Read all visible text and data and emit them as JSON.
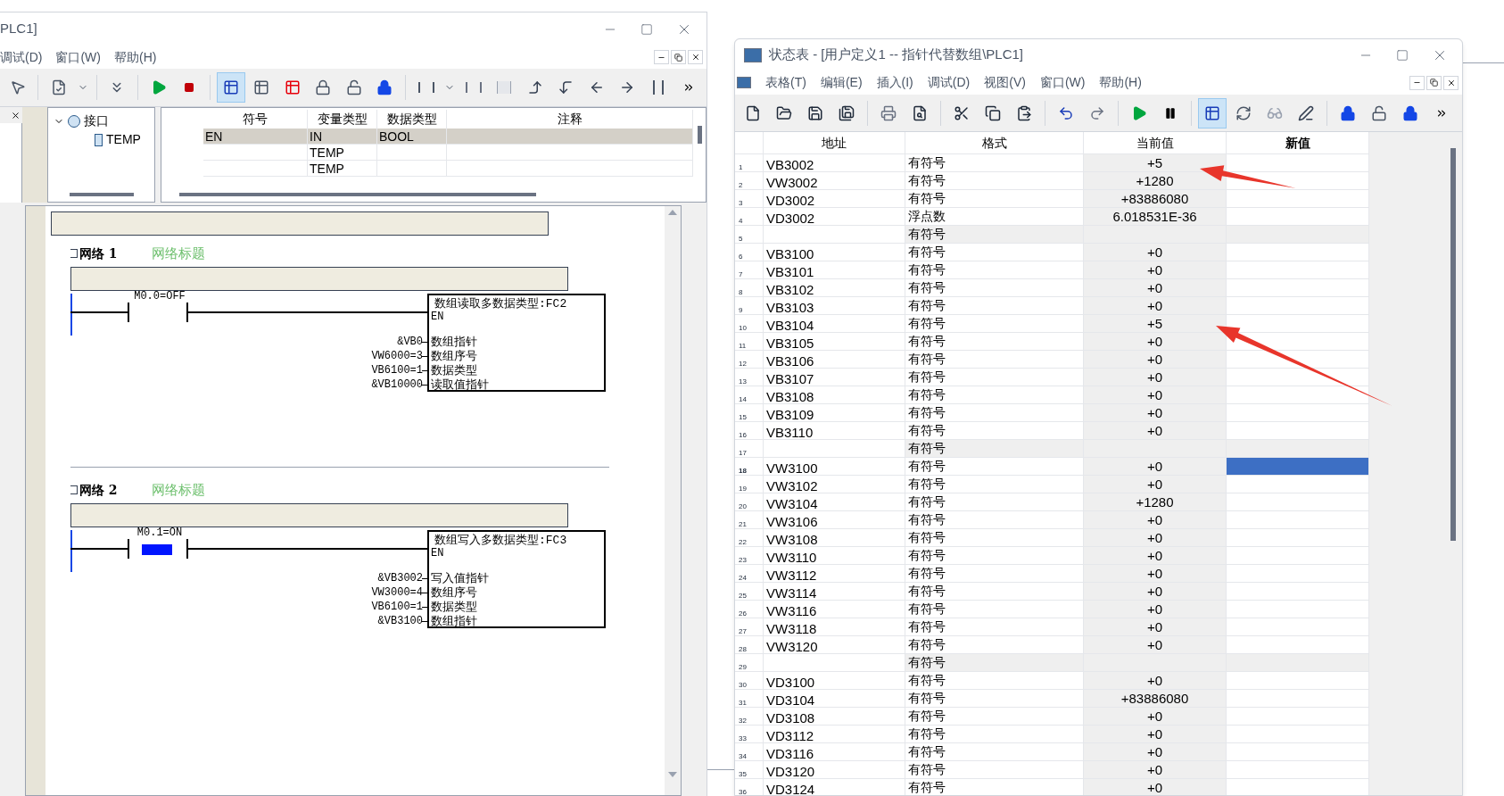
{
  "left_window": {
    "title": "PLC1]",
    "menu": [
      "调试(D)",
      "窗口(W)",
      "帮助(H)"
    ],
    "toolbar": [
      {
        "kind": "pointer",
        "pressed": false
      },
      {
        "kind": "separator"
      },
      {
        "kind": "doc-check",
        "pressed": false
      },
      {
        "kind": "dropdown",
        "pressed": false
      },
      {
        "kind": "separator"
      },
      {
        "kind": "download",
        "pressed": false
      },
      {
        "kind": "separator"
      },
      {
        "kind": "run",
        "pressed": false
      },
      {
        "kind": "stop",
        "pressed": false
      },
      {
        "kind": "separator"
      },
      {
        "kind": "chart",
        "pressed": true
      },
      {
        "kind": "chart-plain",
        "pressed": false
      },
      {
        "kind": "chart-red",
        "pressed": false
      },
      {
        "kind": "lock",
        "pressed": false
      },
      {
        "kind": "unlock",
        "pressed": false
      },
      {
        "kind": "lock-blue",
        "pressed": false
      },
      {
        "kind": "separator"
      },
      {
        "kind": "insert-network",
        "pressed": false
      },
      {
        "kind": "dropdown",
        "pressed": false
      },
      {
        "kind": "delete-network",
        "pressed": false
      },
      {
        "kind": "n-contact",
        "pressed": false
      },
      {
        "kind": "branch-up",
        "pressed": false
      },
      {
        "kind": "branch-down",
        "pressed": false
      },
      {
        "kind": "line-left",
        "pressed": false
      },
      {
        "kind": "line-right",
        "pressed": false
      },
      {
        "kind": "contact",
        "pressed": false
      },
      {
        "kind": "more",
        "pressed": false
      }
    ],
    "tree": {
      "label": "接口",
      "expanded": true,
      "children": [
        {
          "label": "TEMP"
        }
      ]
    },
    "interface_table": {
      "columns": [
        "符号",
        "变量类型",
        "数据类型",
        "注释"
      ],
      "rows": [
        {
          "cells": [
            "EN",
            "IN",
            "BOOL",
            ""
          ],
          "selected": true
        },
        {
          "cells": [
            "",
            "TEMP",
            "",
            ""
          ],
          "selected": false
        },
        {
          "cells": [
            "",
            "TEMP",
            "",
            ""
          ],
          "selected": false
        }
      ]
    },
    "networks": [
      {
        "heading": "网络 1",
        "title": "网络标题",
        "contact": {
          "label": "M0.0=OFF",
          "energized": false
        },
        "block": {
          "title": "数组读取多数据类型:FC2",
          "enable": "EN",
          "pins": [
            {
              "operand": "&VB0",
              "name": "数组指针"
            },
            {
              "operand": "VW6000=3",
              "name": "数组序号"
            },
            {
              "operand": "VB6100=1",
              "name": "数据类型"
            },
            {
              "operand": "&VB10000",
              "name": "读取值指针"
            }
          ]
        }
      },
      {
        "heading": "网络 2",
        "title": "网络标题",
        "contact": {
          "label": "M0.1=ON",
          "energized": true
        },
        "block": {
          "title": "数组写入多数据类型:FC3",
          "enable": "EN",
          "pins": [
            {
              "operand": "&VB3002",
              "name": "写入值指针"
            },
            {
              "operand": "VW3000=4",
              "name": "数组序号"
            },
            {
              "operand": "VB6100=1",
              "name": "数据类型"
            },
            {
              "operand": "&VB3100",
              "name": "数组指针"
            }
          ]
        }
      }
    ]
  },
  "right_window": {
    "title": "状态表 - [用户定义1 -- 指针代替数组\\PLC1]",
    "menu": [
      "表格(T)",
      "编辑(E)",
      "插入(I)",
      "调试(D)",
      "视图(V)",
      "窗口(W)",
      "帮助(H)"
    ],
    "toolbar": [
      {
        "kind": "new",
        "pressed": false
      },
      {
        "kind": "open",
        "pressed": false
      },
      {
        "kind": "save",
        "pressed": false
      },
      {
        "kind": "save-all",
        "pressed": false
      },
      {
        "kind": "separator"
      },
      {
        "kind": "print",
        "pressed": false
      },
      {
        "kind": "preview",
        "pressed": false
      },
      {
        "kind": "separator"
      },
      {
        "kind": "cut",
        "pressed": false
      },
      {
        "kind": "copy",
        "pressed": false
      },
      {
        "kind": "paste",
        "pressed": false
      },
      {
        "kind": "separator"
      },
      {
        "kind": "undo",
        "pressed": false
      },
      {
        "kind": "redo",
        "pressed": false
      },
      {
        "kind": "separator"
      },
      {
        "kind": "run",
        "pressed": false
      },
      {
        "kind": "pause",
        "pressed": false
      },
      {
        "kind": "separator"
      },
      {
        "kind": "chart",
        "pressed": true
      },
      {
        "kind": "chart-refresh",
        "pressed": false
      },
      {
        "kind": "glasses",
        "pressed": false
      },
      {
        "kind": "pencil",
        "pressed": false
      },
      {
        "kind": "separator"
      },
      {
        "kind": "lock-blue",
        "pressed": false
      },
      {
        "kind": "unlock",
        "pressed": false
      },
      {
        "kind": "lock-blue",
        "pressed": false
      },
      {
        "kind": "more",
        "pressed": false
      }
    ],
    "table": {
      "columns": [
        "地址",
        "格式",
        "当前值",
        "新值"
      ],
      "rows": [
        {
          "number": "1",
          "address": "VB3002",
          "format": "有符号",
          "current": "+5",
          "selected": false
        },
        {
          "number": "2",
          "address": "VW3002",
          "format": "有符号",
          "current": "+1280",
          "selected": false
        },
        {
          "number": "3",
          "address": "VD3002",
          "format": "有符号",
          "current": "+83886080",
          "selected": false
        },
        {
          "number": "4",
          "address": "VD3002",
          "format": "浮点数",
          "current": "6.018531E-36",
          "selected": false
        },
        {
          "number": "5",
          "address": "",
          "format": "有符号",
          "current": "",
          "selected": false
        },
        {
          "number": "6",
          "address": "VB3100",
          "format": "有符号",
          "current": "+0",
          "selected": false
        },
        {
          "number": "7",
          "address": "VB3101",
          "format": "有符号",
          "current": "+0",
          "selected": false
        },
        {
          "number": "8",
          "address": "VB3102",
          "format": "有符号",
          "current": "+0",
          "selected": false
        },
        {
          "number": "9",
          "address": "VB3103",
          "format": "有符号",
          "current": "+0",
          "selected": false
        },
        {
          "number": "10",
          "address": "VB3104",
          "format": "有符号",
          "current": "+5",
          "selected": false
        },
        {
          "number": "11",
          "address": "VB3105",
          "format": "有符号",
          "current": "+0",
          "selected": false
        },
        {
          "number": "12",
          "address": "VB3106",
          "format": "有符号",
          "current": "+0",
          "selected": false
        },
        {
          "number": "13",
          "address": "VB3107",
          "format": "有符号",
          "current": "+0",
          "selected": false
        },
        {
          "number": "14",
          "address": "VB3108",
          "format": "有符号",
          "current": "+0",
          "selected": false
        },
        {
          "number": "15",
          "address": "VB3109",
          "format": "有符号",
          "current": "+0",
          "selected": false
        },
        {
          "number": "16",
          "address": "VB3110",
          "format": "有符号",
          "current": "+0",
          "selected": false
        },
        {
          "number": "17",
          "address": "",
          "format": "有符号",
          "current": "",
          "selected": false
        },
        {
          "number": "18",
          "address": "VW3100",
          "format": "有符号",
          "current": "+0",
          "selected": true
        },
        {
          "number": "19",
          "address": "VW3102",
          "format": "有符号",
          "current": "+0",
          "selected": false
        },
        {
          "number": "20",
          "address": "VW3104",
          "format": "有符号",
          "current": "+1280",
          "selected": false
        },
        {
          "number": "21",
          "address": "VW3106",
          "format": "有符号",
          "current": "+0",
          "selected": false
        },
        {
          "number": "22",
          "address": "VW3108",
          "format": "有符号",
          "current": "+0",
          "selected": false
        },
        {
          "number": "23",
          "address": "VW3110",
          "format": "有符号",
          "current": "+0",
          "selected": false
        },
        {
          "number": "24",
          "address": "VW3112",
          "format": "有符号",
          "current": "+0",
          "selected": false
        },
        {
          "number": "25",
          "address": "VW3114",
          "format": "有符号",
          "current": "+0",
          "selected": false
        },
        {
          "number": "26",
          "address": "VW3116",
          "format": "有符号",
          "current": "+0",
          "selected": false
        },
        {
          "number": "27",
          "address": "VW3118",
          "format": "有符号",
          "current": "+0",
          "selected": false
        },
        {
          "number": "28",
          "address": "VW3120",
          "format": "有符号",
          "current": "+0",
          "selected": false
        },
        {
          "number": "29",
          "address": "",
          "format": "有符号",
          "current": "",
          "selected": false
        },
        {
          "number": "30",
          "address": "VD3100",
          "format": "有符号",
          "current": "+0",
          "selected": false
        },
        {
          "number": "31",
          "address": "VD3104",
          "format": "有符号",
          "current": "+83886080",
          "selected": false
        },
        {
          "number": "32",
          "address": "VD3108",
          "format": "有符号",
          "current": "+0",
          "selected": false
        },
        {
          "number": "33",
          "address": "VD3112",
          "format": "有符号",
          "current": "+0",
          "selected": false
        },
        {
          "number": "34",
          "address": "VD3116",
          "format": "有符号",
          "current": "+0",
          "selected": false
        },
        {
          "number": "35",
          "address": "VD3120",
          "format": "有符号",
          "current": "+0",
          "selected": false
        },
        {
          "number": "36",
          "address": "VD3124",
          "format": "有符号",
          "current": "+0",
          "selected": false
        }
      ]
    }
  },
  "annotations": [
    {
      "kind": "arrow",
      "color": "#e8352b"
    },
    {
      "kind": "arrow",
      "color": "#e8352b"
    }
  ]
}
